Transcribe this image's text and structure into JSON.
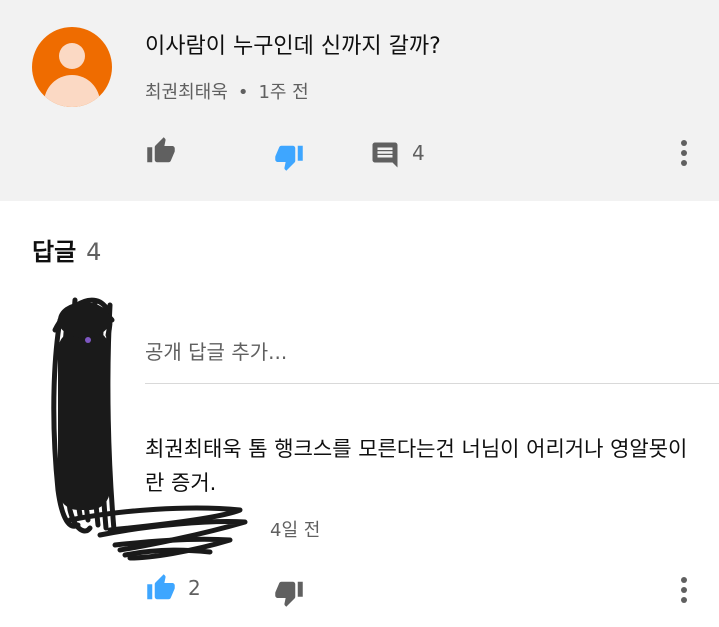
{
  "comment": {
    "text": "이사람이 누구인데 신까지 갈까?",
    "author": "최권최태욱",
    "separator": "•",
    "time": "1주 전",
    "reply_count": "4",
    "avatar_color": "#ef6c00",
    "like_icon": "thumbs-up-icon",
    "dislike_icon": "thumbs-down-icon",
    "dislike_active_color": "#3ea6ff",
    "reply_icon": "reply-comment-icon",
    "menu_icon": "more-vert-icon"
  },
  "replies": {
    "title": "답글",
    "count": "4",
    "input_placeholder": "공개 답글 추가...",
    "items": [
      {
        "text": "최권최태욱 톰 행크스를 모른다는건 너님이 어리거나 영알못이란 증거.",
        "time": "4일 전",
        "like_count": "2",
        "like_active_color": "#3ea6ff",
        "like_icon": "thumbs-up-icon",
        "dislike_icon": "thumbs-down-icon",
        "menu_icon": "more-vert-icon"
      }
    ]
  }
}
